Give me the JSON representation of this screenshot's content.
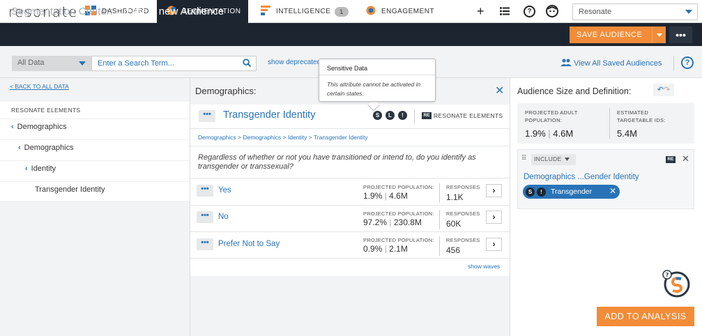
{
  "brand": {
    "logo_text": "resonate"
  },
  "nav": {
    "tabs": [
      {
        "label": "DASHBOARD",
        "icon": "dashboard-grid-icon"
      },
      {
        "label": "SEGMENTATION",
        "icon": "segmentation-icon",
        "active": true
      },
      {
        "label": "INTELLIGENCE",
        "icon": "intelligence-icon",
        "badge": "1"
      },
      {
        "label": "ENGAGEMENT",
        "icon": "engagement-icon"
      }
    ],
    "icons": [
      "plus-icon",
      "list-icon",
      "help-icon",
      "user-icon"
    ],
    "org_select": "Resonate"
  },
  "header": {
    "title_prefix": "Segmentation Center:",
    "title_main": "Create a new Audience",
    "save_label": "SAVE AUDIENCE",
    "more_label": "•••"
  },
  "search": {
    "scope": "All Data",
    "placeholder": "Enter a Search Term...",
    "show_deprecated": "show deprecated",
    "view_all": "View All Saved Audiences"
  },
  "left": {
    "back_label": "< BACK TO ALL DATA",
    "section_label": "RESONATE ELEMENTS",
    "crumbs": [
      "Demographics",
      "Demographics",
      "Identity"
    ],
    "leaf": "Transgender Identity"
  },
  "middle": {
    "title": "Demographics:",
    "attribute": "Transgender Identity",
    "flags": [
      "S",
      "L",
      "!"
    ],
    "source_badge": "RE",
    "source_label": "RESONATE ELEMENTS",
    "path": "Demographics > Demographics > Identity > Transgender Identity",
    "question": "Regardless of whether or not you have transitioned or intend to, do you identify as transgender or transsexual?",
    "pop_caption": "PROJECTED POPULATION:",
    "resp_caption": "RESPONSES",
    "answers": [
      {
        "label": "Yes",
        "pct": "1.9%",
        "pop": "4.6M",
        "responses": "1.1K"
      },
      {
        "label": "No",
        "pct": "97.2%",
        "pop": "230.8M",
        "responses": "60K"
      },
      {
        "label": "Prefer Not to Say",
        "pct": "0.9%",
        "pop": "2.1M",
        "responses": "456"
      }
    ],
    "show_waves": "show waves"
  },
  "tooltip": {
    "title": "Sensitive Data",
    "body": "This attribute cannot be activated in certain states."
  },
  "right": {
    "title": "Audience Size and Definition:",
    "adult_caption": "PROJECTED ADULT POPULATION:",
    "adult_pct": "1.9%",
    "adult_pop": "4.6M",
    "ids_caption": "ESTIMATED TARGETABLE IDS:",
    "ids_value": "5.4M",
    "include_label": "INCLUDE",
    "rule_badge": "RE",
    "rule_name": "Demographics ...Gender Identity",
    "chip_flags": [
      "S",
      "!"
    ],
    "chip_label": "Transgender",
    "add_label": "ADD TO ANALYSIS"
  },
  "colors": {
    "accent": "#2873b8",
    "orange": "#f28c38",
    "dark": "#1d2530"
  }
}
